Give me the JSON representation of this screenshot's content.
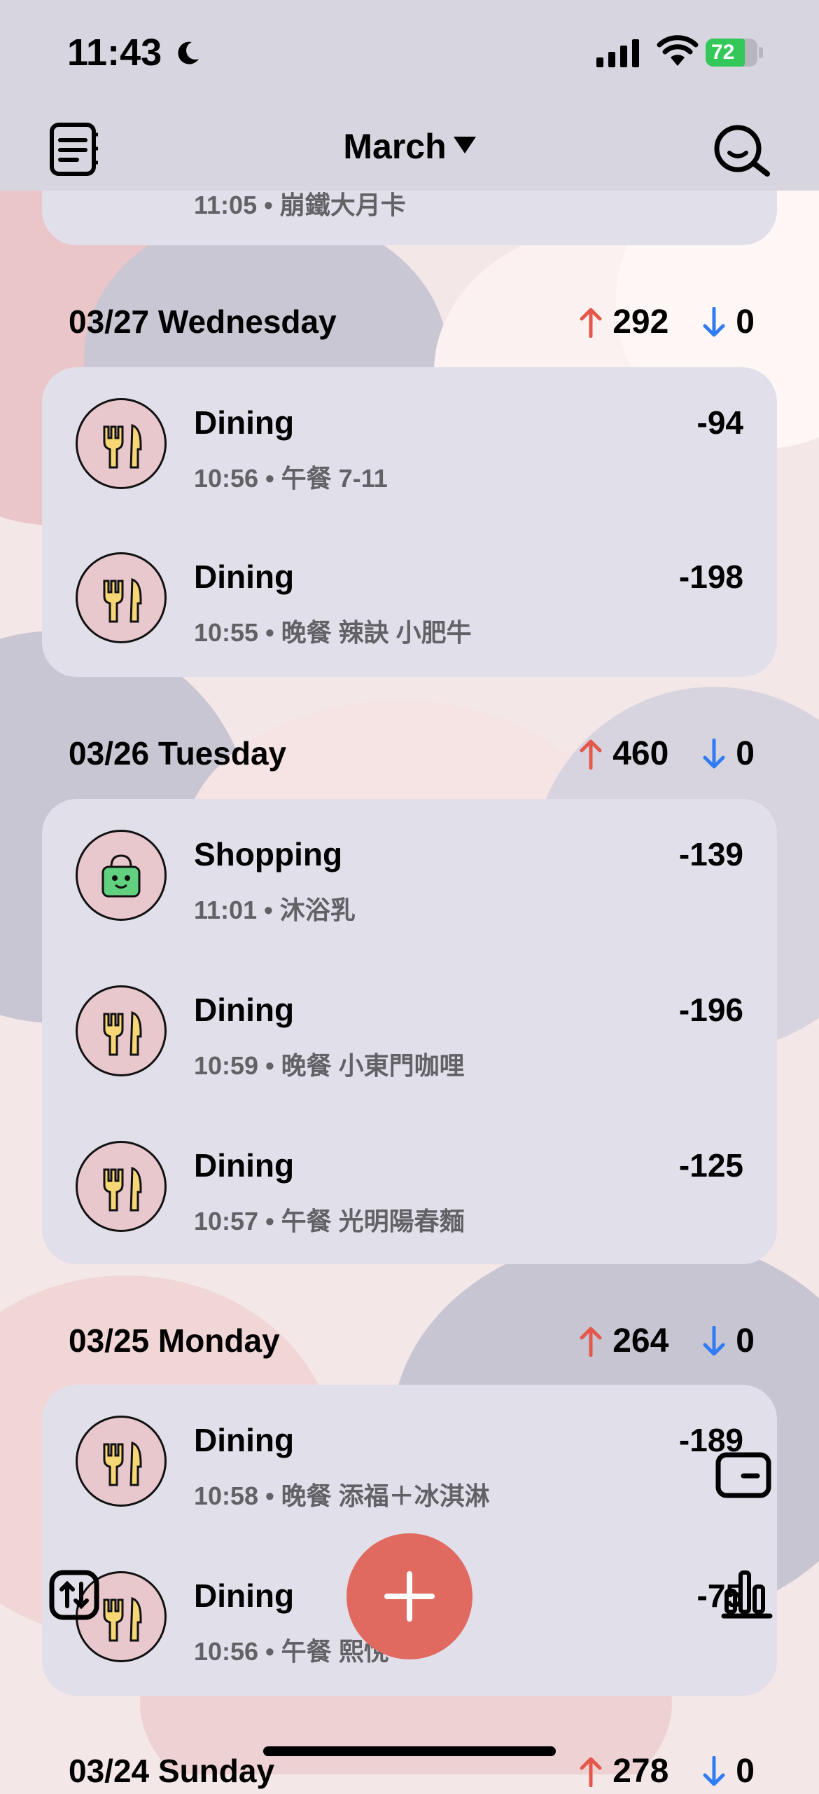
{
  "status_bar": {
    "time": "11:43",
    "battery": "72"
  },
  "header": {
    "month": "March"
  },
  "partial_top": {
    "subtitle": "11:05 • 崩鐵大月卡"
  },
  "days": [
    {
      "date": "03/27 Wednesday",
      "expense": "292",
      "income": "0",
      "items": [
        {
          "icon": "dining-icon",
          "title": "Dining",
          "amount": "-94",
          "sub": "10:56 • 午餐 7-11"
        },
        {
          "icon": "dining-icon",
          "title": "Dining",
          "amount": "-198",
          "sub": "10:55 • 晚餐 辣訣 小肥牛"
        }
      ]
    },
    {
      "date": "03/26 Tuesday",
      "expense": "460",
      "income": "0",
      "items": [
        {
          "icon": "shopping-bag-icon",
          "title": "Shopping",
          "amount": "-139",
          "sub": "11:01 • 沐浴乳"
        },
        {
          "icon": "dining-icon",
          "title": "Dining",
          "amount": "-196",
          "sub": "10:59 • 晚餐 小東門咖哩"
        },
        {
          "icon": "dining-icon",
          "title": "Dining",
          "amount": "-125",
          "sub": "10:57 • 午餐 光明陽春麵"
        }
      ]
    },
    {
      "date": "03/25 Monday",
      "expense": "264",
      "income": "0",
      "items": [
        {
          "icon": "dining-icon",
          "title": "Dining",
          "amount": "-189",
          "sub": "10:58 • 晚餐 添福＋冰淇淋"
        },
        {
          "icon": "dining-icon",
          "title": "Dining",
          "amount": "-75",
          "sub": "10:56 • 午餐 熙悅"
        }
      ]
    }
  ],
  "partial_bottom": {
    "date": "03/24 Sunday",
    "expense": "278",
    "income": "0"
  },
  "colors": {
    "up_arrow": "#e5574b",
    "down_arrow": "#2f7cf6",
    "fab": "#e06a5f"
  }
}
